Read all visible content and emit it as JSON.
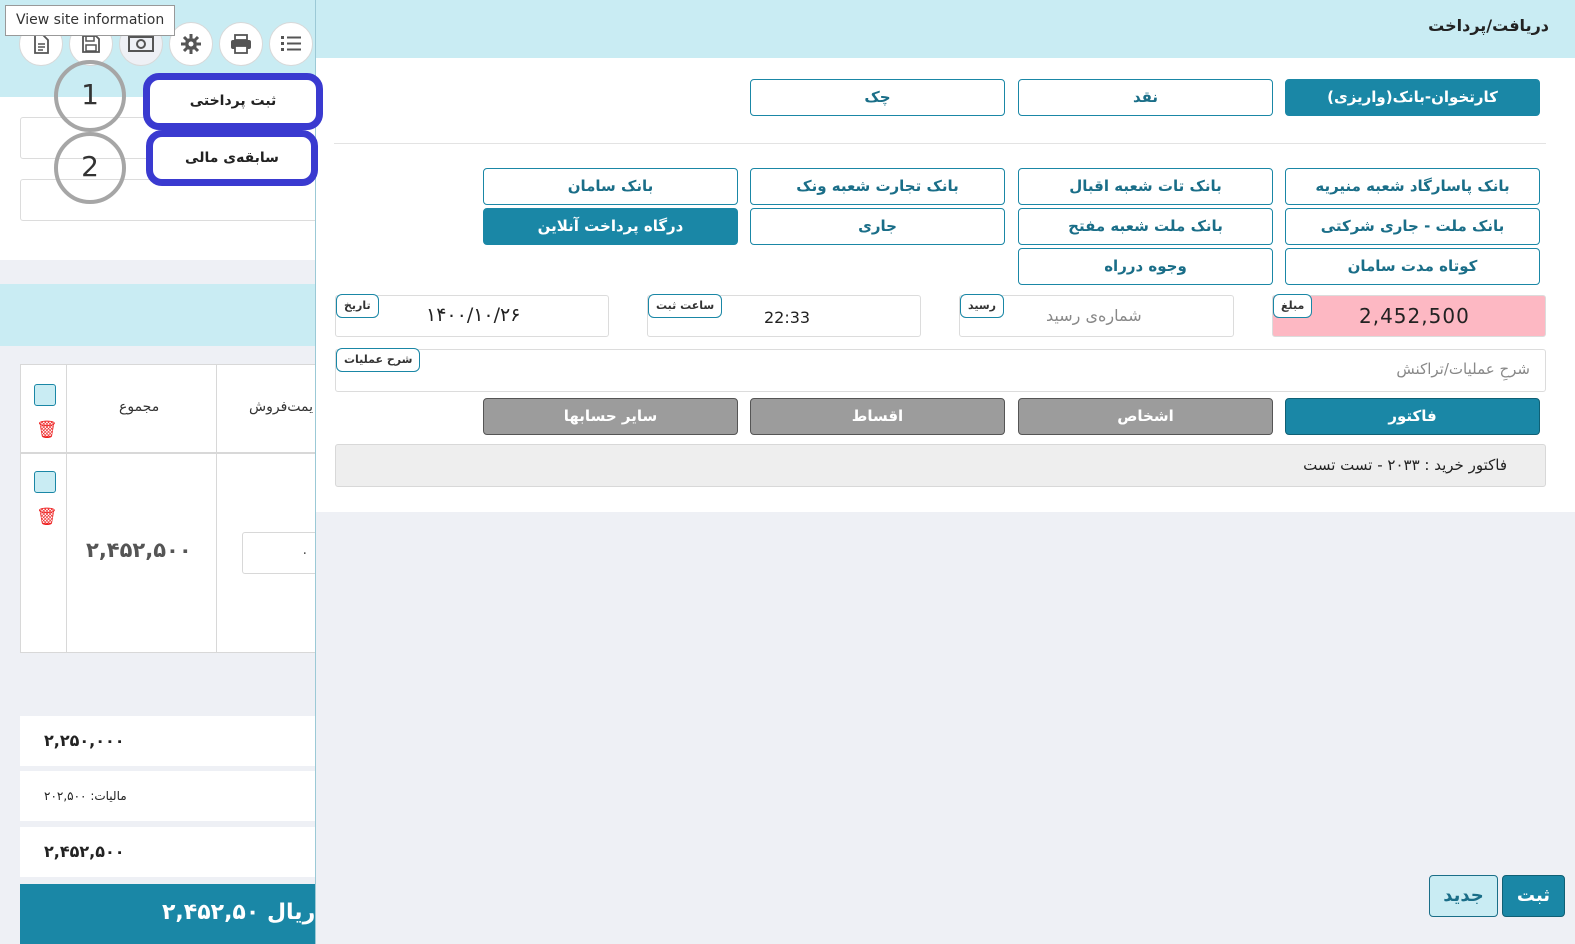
{
  "tooltip": "View site information",
  "toolbar": {
    "icons": [
      "document-icon",
      "save-icon",
      "cash-icon",
      "gear-icon",
      "print-icon",
      "list-icon"
    ]
  },
  "popup_menu": {
    "record_payment": "ثبت پرداختی",
    "financial_history": "سابقه‌ی مالی",
    "step_1": "1",
    "step_2": "2"
  },
  "background": {
    "table_header_total": "مجموع",
    "table_header_price": "یمت‌فروش",
    "row_total": "۲,۴۵۲,۵۰۰",
    "row_qty": "۰",
    "subtotal": "۲,۲۵۰,۰۰۰",
    "tax": "مالیات: ۲۰۲,۵۰۰",
    "total": "۲,۴۵۲,۵۰۰",
    "grand_total": "۲,۴۵۲,۵۰ ریال"
  },
  "modal": {
    "title": "دریافت/پرداخت",
    "payment_types": [
      {
        "label": "کارتخوان-بانک(واریزی)",
        "active": true
      },
      {
        "label": "نقد",
        "active": false
      },
      {
        "label": "چک",
        "active": false
      }
    ],
    "accounts": [
      {
        "label": "بانک پاسارگاد شعبه منیریه",
        "active": false
      },
      {
        "label": "بانک تات شعبه اقبال",
        "active": false
      },
      {
        "label": "بانک تجارت شعبه ونک",
        "active": false
      },
      {
        "label": "بانک سامان",
        "active": false
      },
      {
        "label": "بانک ملت - جاری شرکتی",
        "active": false
      },
      {
        "label": "بانک ملت شعبه مفتح",
        "active": false
      },
      {
        "label": "جاری",
        "active": false
      },
      {
        "label": "درگاه پرداخت آنلاین",
        "active": true
      },
      {
        "label": "کوتاه مدت سامان",
        "active": false
      },
      {
        "label": "وجوه درراه",
        "active": false
      }
    ],
    "fields": {
      "amount_label": "مبلغ",
      "amount_value": "2,452,500",
      "receipt_label": "رسید",
      "receipt_placeholder": "شماره‌ی رسید",
      "time_label": "ساعت ثبت",
      "time_value": "22:33",
      "date_label": "تاریخ",
      "date_value": "۱۴۰۰/۱۰/۲۶",
      "desc_label": "شرح عملیات",
      "desc_placeholder": "شرحِ عملیات/تراکنش"
    },
    "categories": [
      {
        "label": "فاکتور",
        "active": true
      },
      {
        "label": "اشخاص",
        "active": false
      },
      {
        "label": "اقساط",
        "active": false
      },
      {
        "label": "سایر حسابها",
        "active": false
      }
    ],
    "invoice_info": "فاکتور خرید : ۲۰۳۳ - تست تست",
    "new_button": "جدید",
    "save_button": "ثبت"
  }
}
